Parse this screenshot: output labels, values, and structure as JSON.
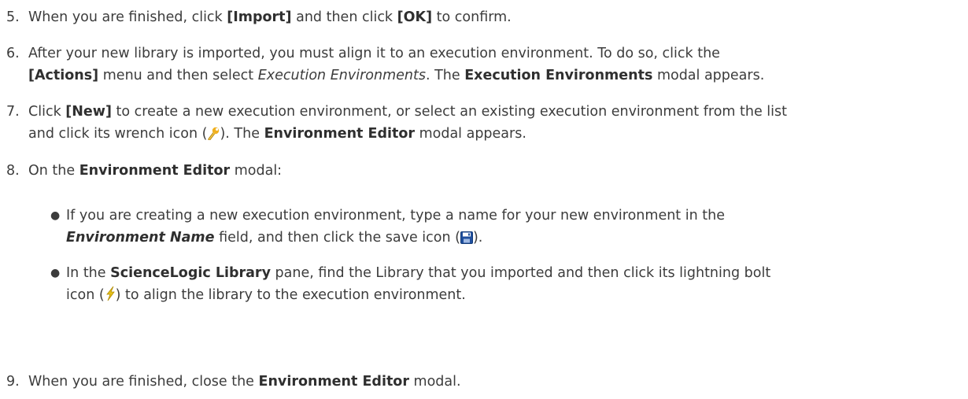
{
  "steps": {
    "s5": {
      "num": "5.",
      "t1": "When you are finished, click ",
      "b1": "[Import]",
      "t2": " and then click ",
      "b2": "[OK]",
      "t3": " to confirm."
    },
    "s6": {
      "num": "6.",
      "t1": "After your new library is imported, you must align it to an execution environment. To do so, click the",
      "b1": "[Actions]",
      "t2": " menu and then select ",
      "i1": "Execution Environments",
      "t3": ". The ",
      "b2": "Execution Environments",
      "t4": " modal appears."
    },
    "s7": {
      "num": "7.",
      "t1": "Click ",
      "b1": "[New]",
      "t2": " to create a new execution environment, or select an existing execution environment from the list",
      "t3": "and click its wrench icon (",
      "t4": "). The ",
      "b2": "Environment Editor",
      "t5": " modal appears."
    },
    "s8": {
      "num": "8.",
      "t1": "On the ",
      "b1": "Environment Editor",
      "t2": " modal:",
      "bullets": {
        "a": {
          "t1": "If you are creating a new execution environment, type a name for your new environment in the",
          "bi1": "Environment Name",
          "t2": " field, and then click the save icon (",
          "t3": ")."
        },
        "b": {
          "t1": "In the ",
          "b1": "ScienceLogic Library",
          "t2": " pane, find the Library that you imported and then click its lightning bolt",
          "t3": "icon (",
          "t4": ") to align the library to the execution environment."
        }
      }
    },
    "s9": {
      "num": "9.",
      "t1": "When you are finished, close the ",
      "b1": "Environment Editor",
      "t2": " modal."
    }
  },
  "icons": {
    "wrench": "wrench-icon",
    "save": "save-icon",
    "lightning": "lightning-bolt-icon"
  },
  "colors": {
    "text": "#3c3c3c",
    "save_icon": "#1f4f9e",
    "lightning_icon": "#e8c31a",
    "wrench_icon": "#f0b020"
  }
}
